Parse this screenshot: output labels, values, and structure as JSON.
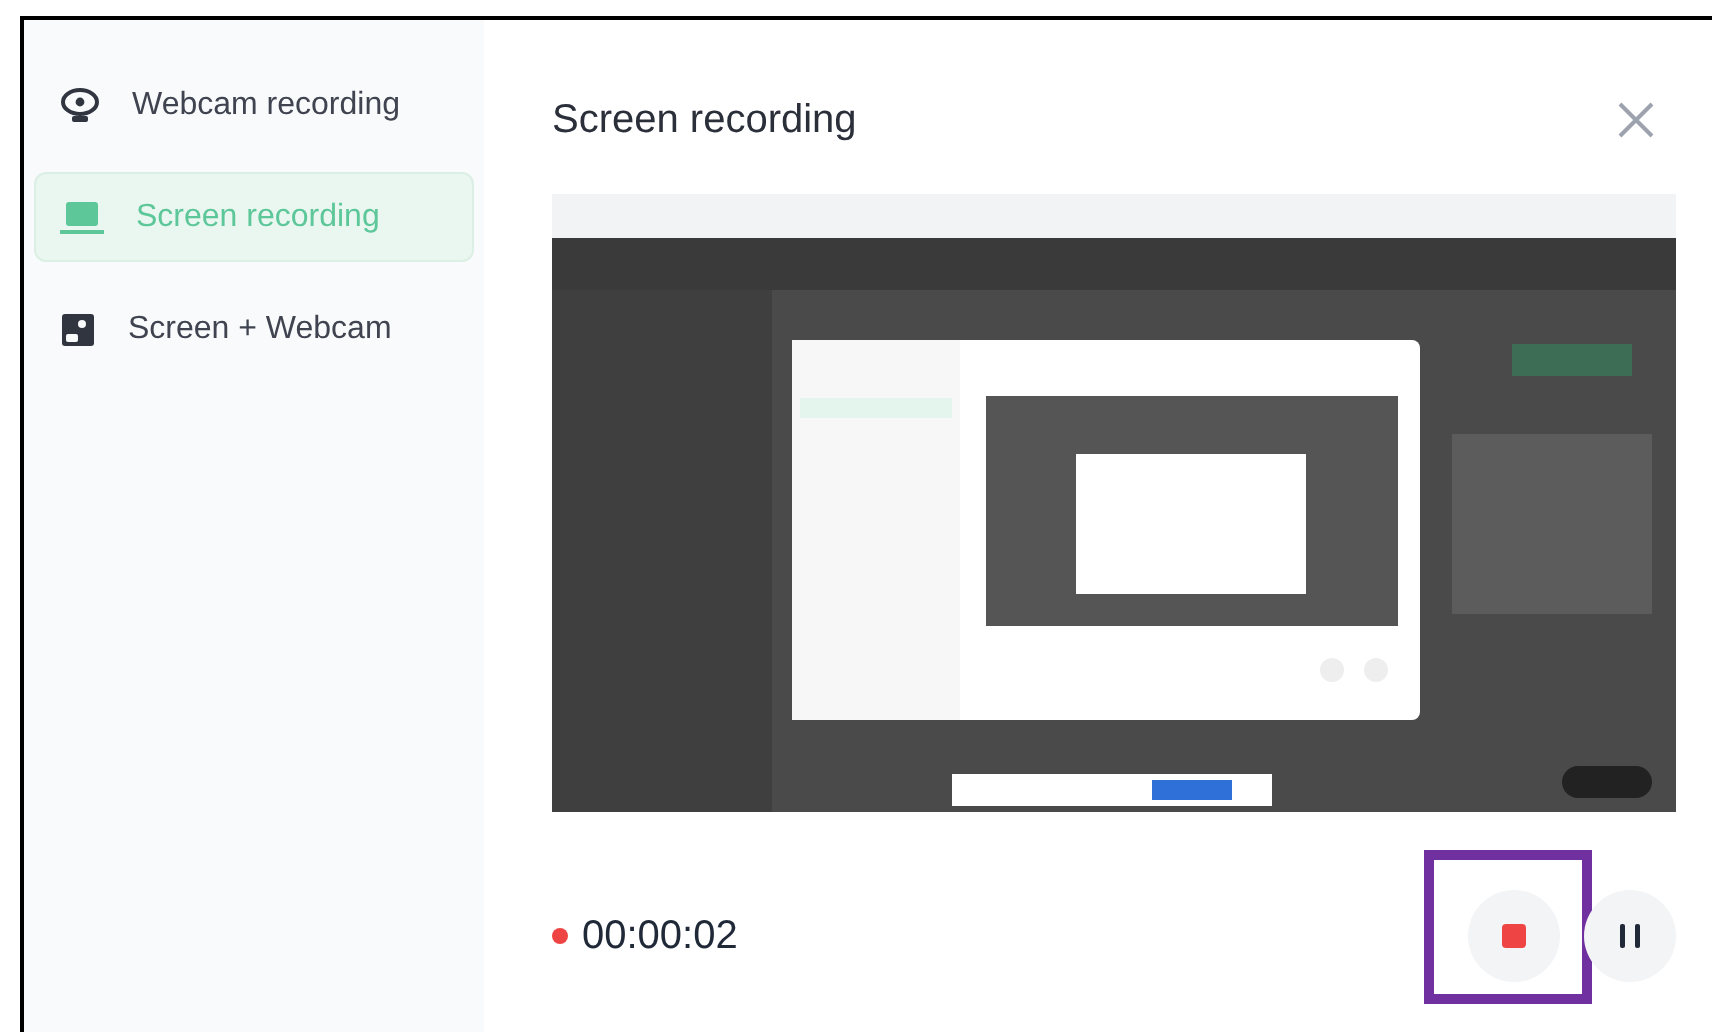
{
  "sidebar": {
    "items": [
      {
        "kind": "webcam",
        "label": "Webcam recording",
        "selected": false
      },
      {
        "kind": "screen",
        "label": "Screen recording",
        "selected": true
      },
      {
        "kind": "screen_webcam",
        "label": "Screen + Webcam",
        "selected": false
      }
    ]
  },
  "dialog": {
    "title": "Screen recording",
    "recording": {
      "time": "00:00:02",
      "live": true
    },
    "controls": [
      {
        "kind": "stop",
        "highlighted": true
      },
      {
        "kind": "pause",
        "highlighted": false
      }
    ]
  }
}
